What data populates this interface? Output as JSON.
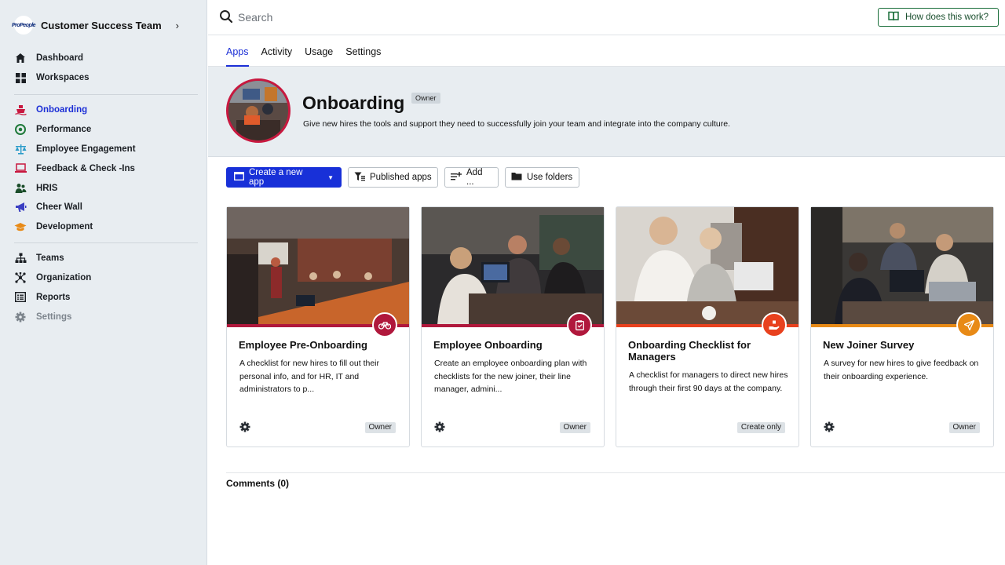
{
  "sidebar": {
    "team": {
      "logo_text": "ProPeople",
      "name": "Customer Success Team",
      "chevron": "›"
    },
    "group1": [
      {
        "label": "Dashboard",
        "icon": "home-icon"
      },
      {
        "label": "Workspaces",
        "icon": "grid-icon"
      }
    ],
    "group2": [
      {
        "label": "Onboarding",
        "icon": "ship-icon",
        "active": true
      },
      {
        "label": "Performance",
        "icon": "target-icon"
      },
      {
        "label": "Employee Engagement",
        "icon": "scale-icon"
      },
      {
        "label": "Feedback & Check -Ins",
        "icon": "laptop-icon"
      },
      {
        "label": "HRIS",
        "icon": "people-icon"
      },
      {
        "label": "Cheer Wall",
        "icon": "megaphone-icon"
      },
      {
        "label": "Development",
        "icon": "graduation-icon"
      }
    ],
    "group3": [
      {
        "label": "Teams",
        "icon": "hierarchy-icon"
      },
      {
        "label": "Organization",
        "icon": "network-icon"
      },
      {
        "label": "Reports",
        "icon": "report-icon"
      },
      {
        "label": "Settings",
        "icon": "gear-icon"
      }
    ]
  },
  "topbar": {
    "search_placeholder": "Search",
    "help_label": "How does this work?"
  },
  "tabs": [
    "Apps",
    "Activity",
    "Usage",
    "Settings"
  ],
  "header": {
    "title": "Onboarding",
    "badge": "Owner",
    "description": "Give new hires the tools and support they need to successfully join your team and integrate into the company culture."
  },
  "toolbar": {
    "create": "Create a new app",
    "published": "Published apps",
    "add": "Add ...",
    "folders": "Use folders"
  },
  "cards": [
    {
      "title": "Employee Pre-Onboarding",
      "description": "A checklist for new hires to fill out their personal info, and for HR, IT and administrators to p...",
      "role": "Owner",
      "accent": "#b0183c",
      "icon": "bicycle-icon"
    },
    {
      "title": "Employee Onboarding",
      "description": "Create an employee onboarding plan with checklists for the new joiner, their line manager, admini...",
      "role": "Owner",
      "accent": "#b0183c",
      "icon": "clipboard-icon"
    },
    {
      "title": "Onboarding Checklist for Managers",
      "description": "A checklist for managers to direct new hires through their first 90 days at the company.",
      "role": "Create only",
      "accent": "#e8411e",
      "icon": "hand-icon"
    },
    {
      "title": "New Joiner Survey",
      "description": "A survey for new hires to give feedback on their onboarding experience.",
      "role": "Owner",
      "accent": "#e88a16",
      "icon": "paper-plane-icon"
    }
  ],
  "comments_label": "Comments (0)"
}
